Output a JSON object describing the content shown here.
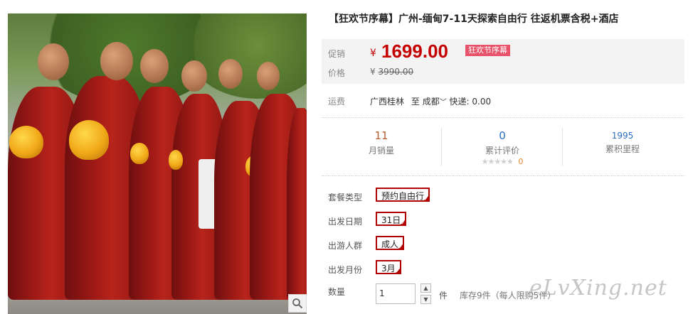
{
  "product": {
    "title": "【狂欢节序幕】广州-缅甸7-11天探索自由行 往返机票含税+酒店",
    "photo_alt": "monks"
  },
  "price": {
    "promo_label": "促销",
    "currency": "¥",
    "current": "1699.00",
    "badge": "狂欢节序幕",
    "orig_label": "价格",
    "original": "3990.00"
  },
  "shipping": {
    "label": "运费",
    "from": "广西桂林",
    "to_word": "至",
    "destination": "成都",
    "express": "快递: 0.00"
  },
  "stats": [
    {
      "value": "11",
      "caption": "月销量",
      "color": "#b35e2e"
    },
    {
      "value": "0",
      "caption": "累计评价",
      "color": "#2a6ec1",
      "rating_count": "0"
    },
    {
      "value": "1995",
      "caption": "累积里程",
      "color": "#2a6ec1"
    }
  ],
  "options": [
    {
      "label": "套餐类型",
      "value": "预约自由行"
    },
    {
      "label": "出发日期",
      "value": "31日"
    },
    {
      "label": "出游人群",
      "value": "成人"
    },
    {
      "label": "出发月份",
      "value": "3月"
    }
  ],
  "quantity": {
    "label": "数量",
    "value": "1",
    "unit": "件",
    "stock": "库存9件",
    "limit": "（每人限购5件）"
  },
  "watermark": "eLvXing.net",
  "colors": {
    "accent": "#c40000",
    "badge": "#e9536a",
    "option_border": "#b10000"
  }
}
